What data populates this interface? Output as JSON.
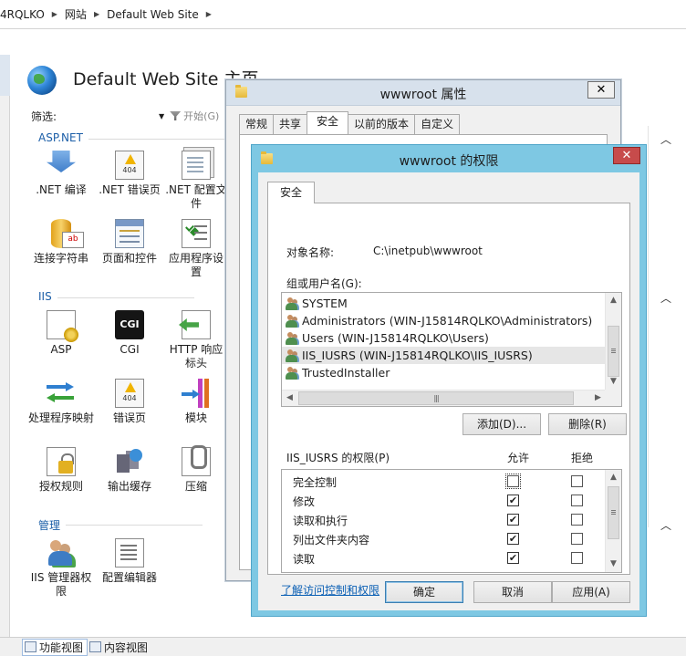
{
  "breadcrumb": {
    "items": [
      "4RQLKO",
      "网站",
      "Default Web Site"
    ]
  },
  "iis": {
    "page_title": "Default Web Site 主页",
    "filter_label": "筛选:",
    "start_label": "开始(G)",
    "groups": {
      "aspnet": "ASP.NET",
      "iis": "IIS",
      "management": "管理"
    },
    "features": {
      "net_compile": ".NET 编译",
      "net_error": ".NET 错误页",
      "net_config": ".NET 配置文件",
      "conn_strings": "连接字符串",
      "pages_controls": "页面和控件",
      "app_settings": "应用程序设置",
      "asp": "ASP",
      "cgi": "CGI",
      "http_headers": "HTTP 响应标头",
      "handler_mappings": "处理程序映射",
      "error_pages": "错误页",
      "modules": "模块",
      "auth_rules": "授权规则",
      "output_cache": "输出缓存",
      "compression": "压缩",
      "iis_mgr_perms": "IIS 管理器权限",
      "config_editor": "配置编辑器"
    },
    "cgi_icon_text": "CGI",
    "statusbar": {
      "features_view": "功能视图",
      "content_view": "内容视图"
    }
  },
  "props_dialog": {
    "title": "wwwroot 属性",
    "tabs": [
      "常规",
      "共享",
      "安全",
      "以前的版本",
      "自定义"
    ],
    "active_tab": "安全"
  },
  "perm_dialog": {
    "title": "wwwroot 的权限",
    "tab": "安全",
    "object_label": "对象名称:",
    "object_value": "C:\\inetpub\\wwwroot",
    "group_label": "组或用户名(G):",
    "users": [
      "SYSTEM",
      "Administrators (WIN-J15814RQLKO\\Administrators)",
      "Users (WIN-J15814RQLKO\\Users)",
      "IIS_IUSRS (WIN-J15814RQLKO\\IIS_IUSRS)",
      "TrustedInstaller"
    ],
    "selected_user_index": 3,
    "add_button": "添加(D)...",
    "remove_button": "删除(R)",
    "perm_label": "IIS_IUSRS 的权限(P)",
    "allow_header": "允许",
    "deny_header": "拒绝",
    "permissions": [
      {
        "name": "完全控制",
        "allow": false,
        "deny": false
      },
      {
        "name": "修改",
        "allow": true,
        "deny": false
      },
      {
        "name": "读取和执行",
        "allow": true,
        "deny": false
      },
      {
        "name": "列出文件夹内容",
        "allow": true,
        "deny": false
      },
      {
        "name": "读取",
        "allow": true,
        "deny": false
      }
    ],
    "link_text": "了解访问控制和权限",
    "ok_button": "确定",
    "cancel_button": "取消",
    "apply_button": "应用(A)"
  },
  "icons": {
    "close": "close-icon",
    "folder": "folder-icon",
    "user": "user-group-icon",
    "globe": "globe-icon"
  },
  "colors": {
    "active_title": "#7ec8e3",
    "inactive_title": "#d7e1ec",
    "close_red": "#c74b4b",
    "link": "#0a5fb4",
    "group_header": "#1c5fa8"
  }
}
